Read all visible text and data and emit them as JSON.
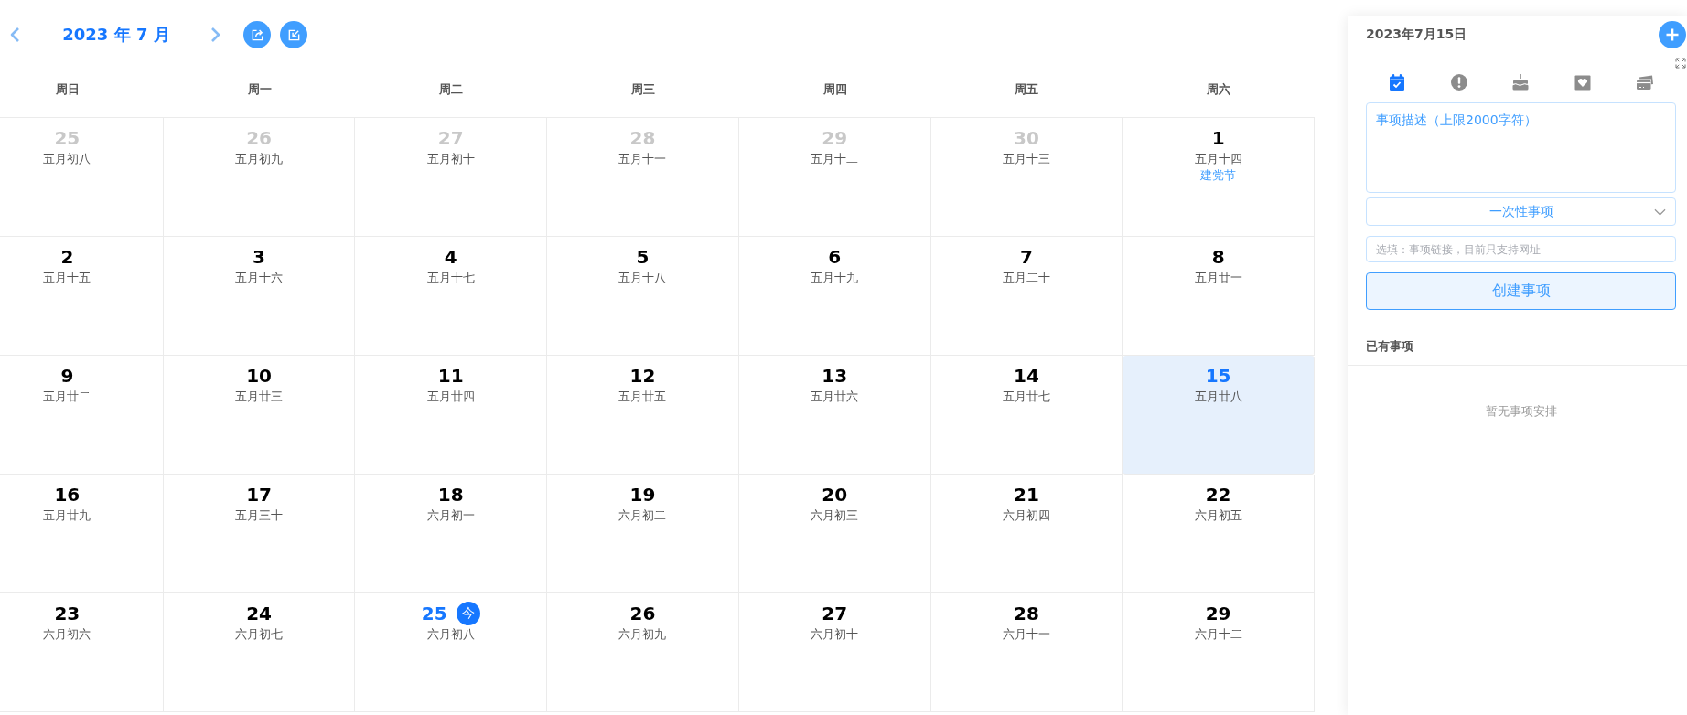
{
  "header": {
    "title": "2023 年 7 月"
  },
  "weekdays": [
    "周日",
    "周一",
    "周二",
    "周三",
    "周四",
    "周五",
    "周六"
  ],
  "weeks": [
    [
      {
        "day": "25",
        "lunar": "五月初八",
        "other_month": true,
        "today": false,
        "selected": false
      },
      {
        "day": "26",
        "lunar": "五月初九",
        "other_month": true,
        "today": false,
        "selected": false
      },
      {
        "day": "27",
        "lunar": "五月初十",
        "other_month": true,
        "today": false,
        "selected": false
      },
      {
        "day": "28",
        "lunar": "五月十一",
        "other_month": true,
        "today": false,
        "selected": false
      },
      {
        "day": "29",
        "lunar": "五月十二",
        "other_month": true,
        "today": false,
        "selected": false
      },
      {
        "day": "30",
        "lunar": "五月十三",
        "other_month": true,
        "today": false,
        "selected": false
      },
      {
        "day": "1",
        "lunar": "五月十四",
        "holiday": "建党节",
        "other_month": false,
        "today": false,
        "selected": false
      }
    ],
    [
      {
        "day": "2",
        "lunar": "五月十五",
        "other_month": false,
        "today": false,
        "selected": false
      },
      {
        "day": "3",
        "lunar": "五月十六",
        "other_month": false,
        "today": false,
        "selected": false
      },
      {
        "day": "4",
        "lunar": "五月十七",
        "other_month": false,
        "today": false,
        "selected": false
      },
      {
        "day": "5",
        "lunar": "五月十八",
        "other_month": false,
        "today": false,
        "selected": false
      },
      {
        "day": "6",
        "lunar": "五月十九",
        "other_month": false,
        "today": false,
        "selected": false
      },
      {
        "day": "7",
        "lunar": "五月二十",
        "other_month": false,
        "today": false,
        "selected": false
      },
      {
        "day": "8",
        "lunar": "五月廿一",
        "other_month": false,
        "today": false,
        "selected": false
      }
    ],
    [
      {
        "day": "9",
        "lunar": "五月廿二",
        "other_month": false,
        "today": false,
        "selected": false
      },
      {
        "day": "10",
        "lunar": "五月廿三",
        "other_month": false,
        "today": false,
        "selected": false
      },
      {
        "day": "11",
        "lunar": "五月廿四",
        "other_month": false,
        "today": false,
        "selected": false
      },
      {
        "day": "12",
        "lunar": "五月廿五",
        "other_month": false,
        "today": false,
        "selected": false
      },
      {
        "day": "13",
        "lunar": "五月廿六",
        "other_month": false,
        "today": false,
        "selected": false
      },
      {
        "day": "14",
        "lunar": "五月廿七",
        "other_month": false,
        "today": false,
        "selected": false
      },
      {
        "day": "15",
        "lunar": "五月廿八",
        "other_month": false,
        "today": false,
        "selected": true
      }
    ],
    [
      {
        "day": "16",
        "lunar": "五月廿九",
        "other_month": false,
        "today": false,
        "selected": false
      },
      {
        "day": "17",
        "lunar": "五月三十",
        "other_month": false,
        "today": false,
        "selected": false
      },
      {
        "day": "18",
        "lunar": "六月初一",
        "other_month": false,
        "today": false,
        "selected": false
      },
      {
        "day": "19",
        "lunar": "六月初二",
        "other_month": false,
        "today": false,
        "selected": false
      },
      {
        "day": "20",
        "lunar": "六月初三",
        "other_month": false,
        "today": false,
        "selected": false
      },
      {
        "day": "21",
        "lunar": "六月初四",
        "other_month": false,
        "today": false,
        "selected": false
      },
      {
        "day": "22",
        "lunar": "六月初五",
        "other_month": false,
        "today": false,
        "selected": false
      }
    ],
    [
      {
        "day": "23",
        "lunar": "六月初六",
        "other_month": false,
        "today": false,
        "selected": false
      },
      {
        "day": "24",
        "lunar": "六月初七",
        "other_month": false,
        "today": false,
        "selected": false
      },
      {
        "day": "25",
        "lunar": "六月初八",
        "badge": "今",
        "other_month": false,
        "today": true,
        "selected": false
      },
      {
        "day": "26",
        "lunar": "六月初九",
        "other_month": false,
        "today": false,
        "selected": false
      },
      {
        "day": "27",
        "lunar": "六月初十",
        "other_month": false,
        "today": false,
        "selected": false
      },
      {
        "day": "28",
        "lunar": "六月十一",
        "other_month": false,
        "today": false,
        "selected": false
      },
      {
        "day": "29",
        "lunar": "六月十二",
        "other_month": false,
        "today": false,
        "selected": false
      }
    ]
  ],
  "panel": {
    "date": "2023年7月15日",
    "types": [
      {
        "kind": "task",
        "selected": true
      },
      {
        "kind": "alert",
        "selected": false
      },
      {
        "kind": "birthday",
        "selected": false
      },
      {
        "kind": "anniversary",
        "selected": false
      },
      {
        "kind": "payment",
        "selected": false
      }
    ],
    "description": {
      "placeholder": "事项描述（上限2000字符）"
    },
    "repeat": {
      "value": "一次性事项"
    },
    "link": {
      "placeholder": "选填：事项链接，目前只支持网址"
    },
    "create_button": "创建事项",
    "list_title": "已有事项",
    "empty_text": "暂无事项安排"
  }
}
